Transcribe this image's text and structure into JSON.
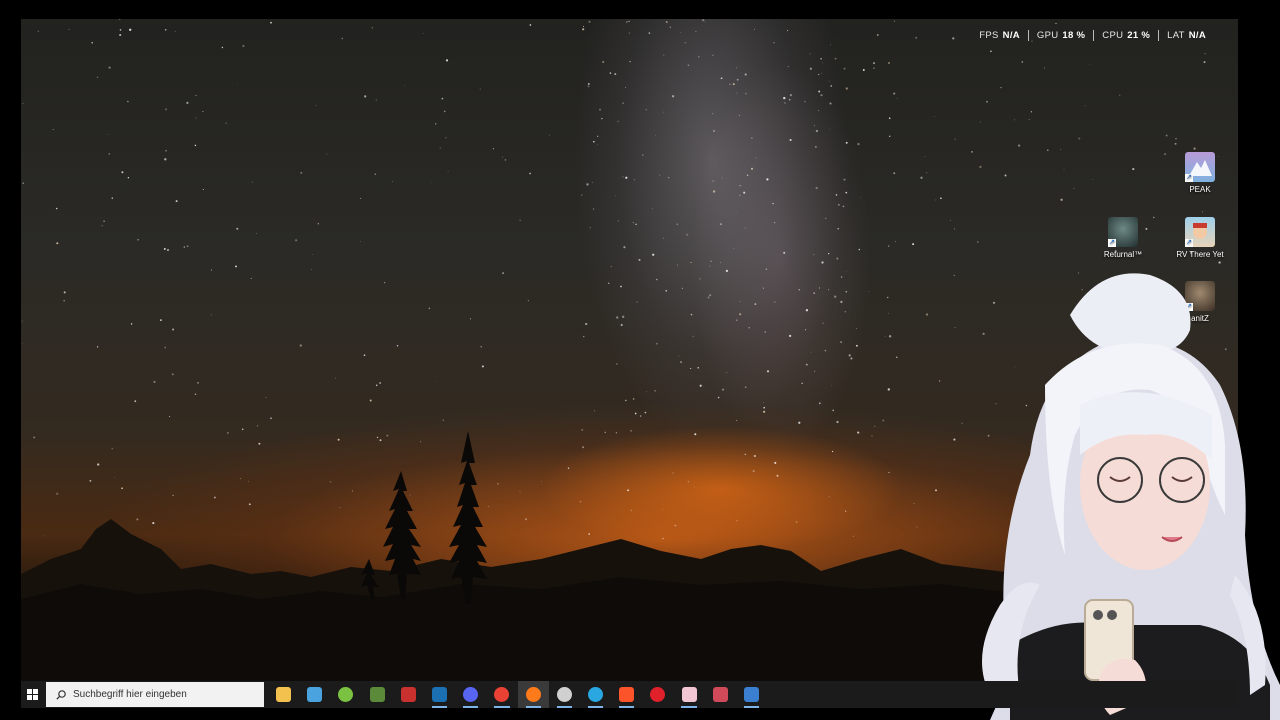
{
  "hud": {
    "items": [
      {
        "label": "FPS",
        "value": "N/A"
      },
      {
        "label": "GPU",
        "value": "18 %"
      },
      {
        "label": "CPU",
        "value": "21 %"
      },
      {
        "label": "LAT",
        "value": "N/A"
      }
    ]
  },
  "desktop_icons": [
    {
      "label": "PEAK",
      "icon": "peak-game-icon",
      "color": "#7fb2e0"
    },
    {
      "label": "Returnal™",
      "icon": "returnal-game-icon",
      "color": "#2f4a4a"
    },
    {
      "label": "RV There Yet",
      "icon": "rv-there-yet-game-icon",
      "color": "#8fc0de"
    },
    {
      "label": "anitZ",
      "icon": "game-shortcut-icon",
      "color": "#6a5a4a"
    }
  ],
  "taskbar": {
    "start_icon": "windows-logo-icon",
    "search_placeholder": "Suchbegriff hier eingeben",
    "apps": [
      {
        "name": "file-explorer",
        "color": "#f2c14e"
      },
      {
        "name": "microsoft-store",
        "color": "#4aa3df"
      },
      {
        "name": "android-app",
        "color": "#7cc242"
      },
      {
        "name": "minecraft-launcher",
        "color": "#5b8a3a"
      },
      {
        "name": "game-launcher",
        "color": "#c8312e"
      },
      {
        "name": "steam",
        "color": "#1b6fb3"
      },
      {
        "name": "discord",
        "color": "#5865f2"
      },
      {
        "name": "chrome",
        "color": "#e94235"
      },
      {
        "name": "firefox",
        "color": "#ff7a1a"
      },
      {
        "name": "performance-overlay",
        "color": "#d0d0d0"
      },
      {
        "name": "edge-like-browser",
        "color": "#2aa7e0"
      },
      {
        "name": "brave",
        "color": "#fb542b"
      },
      {
        "name": "opera",
        "color": "#e0202a"
      },
      {
        "name": "photo-app",
        "color": "#f3c6d3"
      },
      {
        "name": "recording-app",
        "color": "#d04a5a"
      },
      {
        "name": "steam-2",
        "color": "#3a7fd0"
      }
    ]
  }
}
